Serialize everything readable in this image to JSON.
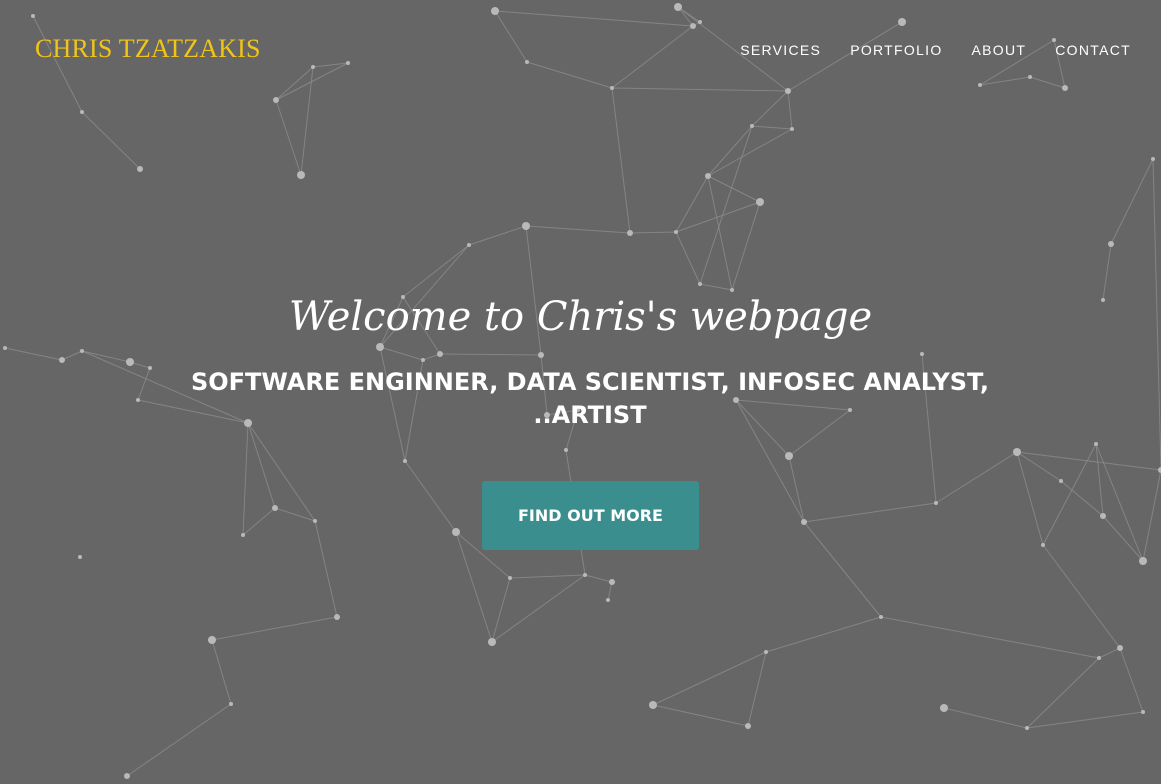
{
  "brand": {
    "name": "CHRIS TZATZAKIS",
    "color": "#f0c419"
  },
  "nav": {
    "items": [
      {
        "label": "SERVICES"
      },
      {
        "label": "PORTFOLIO"
      },
      {
        "label": "ABOUT"
      },
      {
        "label": "CONTACT"
      }
    ]
  },
  "hero": {
    "headline": "Welcome to Chris's webpage",
    "subheading_line1": "SOFTWARE ENGINNER, DATA SCIENTIST, INFOSEC ANALYST,",
    "subheading_line2": "..ARTIST",
    "cta_label": "FIND OUT MORE",
    "cta_color": "#3a8f8e",
    "background_color": "#666666"
  }
}
